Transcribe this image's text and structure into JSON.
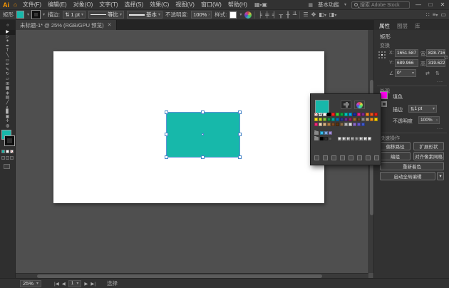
{
  "colors": {
    "teal": "#17b8aa",
    "appearance_fill": "#ff00f0",
    "selection_blue": "#4a86c8"
  },
  "titlebar": {
    "logo": "Ai",
    "menus": [
      "文件(F)",
      "编辑(E)",
      "对象(O)",
      "文字(T)",
      "选择(S)",
      "效果(C)",
      "视图(V)",
      "窗口(W)",
      "帮助(H)"
    ],
    "workspace": "基本功能",
    "search_placeholder": "搜索 Adobe Stock"
  },
  "options_bar": {
    "tool": "矩形",
    "stroke_label": "描边:",
    "stroke_value": "1 pt",
    "profile": "等比",
    "brush": "基本",
    "opacity_label": "不透明度:",
    "opacity_value": "100%",
    "style_label": "样式:"
  },
  "document_tab": {
    "title": "未标题-1* @ 25% (RGB/GPU 预览)",
    "close": "✕"
  },
  "tools": [
    {
      "g": "▶",
      "n": "selection",
      "a": true
    },
    {
      "g": "▷",
      "n": "direct-selection"
    },
    {
      "g": "✶",
      "n": "magic-wand"
    },
    {
      "g": "✒",
      "n": "pen"
    },
    {
      "g": "T",
      "n": "type"
    },
    {
      "g": "╲",
      "n": "line-segment"
    },
    {
      "g": "▭",
      "n": "rectangle"
    },
    {
      "g": "✏",
      "n": "paintbrush"
    },
    {
      "g": "✎",
      "n": "pencil"
    },
    {
      "g": "↻",
      "n": "rotate"
    },
    {
      "g": "▱",
      "n": "scale"
    },
    {
      "g": "⊞",
      "n": "shape-builder"
    },
    {
      "g": "▦",
      "n": "perspective-grid"
    },
    {
      "g": "◈",
      "n": "mesh"
    },
    {
      "g": "▤",
      "n": "gradient"
    },
    {
      "g": "╱",
      "n": "eyedropper"
    },
    {
      "g": "◐",
      "n": "blend"
    },
    {
      "g": "▊",
      "n": "column-graph"
    },
    {
      "g": "▣",
      "n": "artboard"
    },
    {
      "g": "✛",
      "n": "hand"
    },
    {
      "g": "◍",
      "n": "zoom"
    }
  ],
  "swatches_popup": {
    "row1": [
      "none",
      "reg",
      "#ffffff",
      "#000000",
      "#ff1f1f",
      "#41d439",
      "#0bab45",
      "#00c7b8",
      "#00a8ec",
      "#1d2fa3",
      "#e9218c",
      "#7c2b8f",
      "#f68b1f",
      "#f2541b",
      "#e2231a"
    ],
    "row2": [
      "#fde021",
      "#c5d92d",
      "#8cc63e",
      "#0e9347",
      "#00a69c",
      "#0072bb",
      "#2a3b8f",
      "#65308f",
      "#9c1f60",
      "#986b30",
      "#6b4423",
      "#8c8c8c",
      "#c7a875",
      "#f7931e",
      "#ffd400"
    ],
    "row3": [
      "#ee2a7b",
      "#f0d9b5",
      "#d9b382",
      "#b07f48",
      "#7c4a24",
      "#5b3613",
      "#8a6d4a",
      "#b5b5b5",
      "#e0e0e0",
      "#8c6bc8",
      "#6a5acd",
      "#4059c8"
    ],
    "group1": [
      "#35bdee",
      "#7fa8e0",
      "#a58fd8"
    ],
    "group2": [
      "#000000",
      "#2e2e2e",
      "#565656"
    ],
    "gradients": [
      "#f2f2f2",
      "#d9d9d9",
      "#bfbfbf",
      "#a6a6a6",
      "#8c8c8c",
      "#d0d0d0",
      "#e8e8e8",
      "#ffffff"
    ],
    "footer_icons": [
      "swatch-libraries",
      "color-themes",
      "add-to-library",
      "swatch-kinds",
      "swatch-options",
      "new-color-group",
      "new-swatch",
      "delete-swatch"
    ]
  },
  "properties": {
    "tabs": [
      {
        "label": "属性",
        "active": true
      },
      {
        "label": "图层"
      },
      {
        "label": "库"
      }
    ],
    "object_type": "矩形",
    "transform": {
      "title": "变换",
      "x_label": "X:",
      "x": "1651.587",
      "y_label": "Y:",
      "y": "689.966",
      "w_label": "宽:",
      "w": "828.716",
      "h_label": "高:",
      "h": "319.622",
      "angle": "0°",
      "more": "..."
    },
    "appearance": {
      "title": "外观",
      "fill_label": "填色",
      "stroke_label": "描边",
      "stroke_value": "1 pt",
      "opacity_label": "不透明度",
      "opacity_value": "100%",
      "more": "..."
    },
    "quick_actions": [
      "偏移路径",
      "扩展形状",
      "编组",
      "对齐像素网格",
      "重新着色",
      "启动全局编辑"
    ]
  },
  "status_bar": {
    "zoom": "25%",
    "artboard": "1",
    "status": "选择"
  }
}
